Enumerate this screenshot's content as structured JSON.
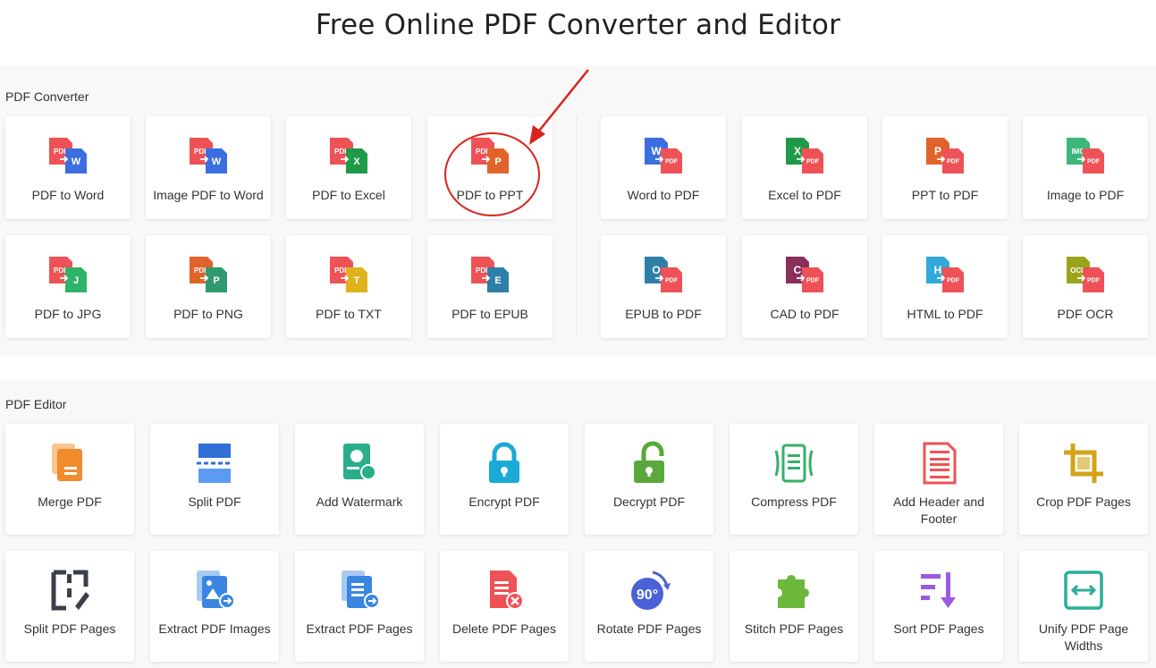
{
  "page": {
    "title": "Free Online PDF Converter and Editor"
  },
  "converter": {
    "label": "PDF Converter",
    "left": [
      {
        "label": "PDF to Word",
        "left_badge": "PDF",
        "left_color": "#ee5256",
        "right_badge": "W",
        "right_color": "#3b6fe0"
      },
      {
        "label": "Image PDF to Word",
        "left_badge": "PDF",
        "left_color": "#ee5256",
        "right_badge": "W",
        "right_color": "#3b6fe0"
      },
      {
        "label": "PDF to Excel",
        "left_badge": "PDF",
        "left_color": "#ee5256",
        "right_badge": "X",
        "right_color": "#1f9a48"
      },
      {
        "label": "PDF to PPT",
        "left_badge": "PDF",
        "left_color": "#ee5256",
        "right_badge": "P",
        "right_color": "#e0632a"
      },
      {
        "label": "PDF to JPG",
        "left_badge": "PDF",
        "left_color": "#ee5256",
        "right_badge": "J",
        "right_color": "#2fb36a"
      },
      {
        "label": "PDF to PNG",
        "left_badge": "PDF",
        "left_color": "#e0632a",
        "right_badge": "P",
        "right_color": "#2f9a6c"
      },
      {
        "label": "PDF to TXT",
        "left_badge": "PDF",
        "left_color": "#ee5256",
        "right_badge": "T",
        "right_color": "#e0b21c"
      },
      {
        "label": "PDF to EPUB",
        "left_badge": "PDF",
        "left_color": "#ee5256",
        "right_badge": "E",
        "right_color": "#2f7fa8"
      }
    ],
    "right": [
      {
        "label": "Word to PDF",
        "left_badge": "W",
        "left_color": "#3b6fe0",
        "right_badge": "PDF",
        "right_color": "#ee5256"
      },
      {
        "label": "Excel to PDF",
        "left_badge": "X",
        "left_color": "#1f9a48",
        "right_badge": "PDF",
        "right_color": "#ee5256"
      },
      {
        "label": "PPT to PDF",
        "left_badge": "P",
        "left_color": "#e0632a",
        "right_badge": "PDF",
        "right_color": "#ee5256"
      },
      {
        "label": "Image to PDF",
        "left_badge": "IMG",
        "left_color": "#3cb67a",
        "right_badge": "PDF",
        "right_color": "#ee5256"
      },
      {
        "label": "EPUB to PDF",
        "left_badge": "O",
        "left_color": "#2f7fa8",
        "right_badge": "PDF",
        "right_color": "#ee5256"
      },
      {
        "label": "CAD to PDF",
        "left_badge": "C",
        "left_color": "#8a2f5c",
        "right_badge": "PDF",
        "right_color": "#ee5256"
      },
      {
        "label": "HTML to PDF",
        "left_badge": "H",
        "left_color": "#33a9d8",
        "right_badge": "PDF",
        "right_color": "#ee5256"
      },
      {
        "label": "PDF OCR",
        "left_badge": "OCR",
        "left_color": "#9aa51c",
        "right_badge": "PDF",
        "right_color": "#ee5256"
      }
    ]
  },
  "editor": {
    "label": "PDF Editor",
    "tools": [
      {
        "label": "Merge PDF",
        "icon": "merge-icon",
        "color": "#f28a2e"
      },
      {
        "label": "Split PDF",
        "icon": "split-icon",
        "color": "#2f6fd6"
      },
      {
        "label": "Add Watermark",
        "icon": "watermark-icon",
        "color": "#2aae8a"
      },
      {
        "label": "Encrypt PDF",
        "icon": "lock-icon",
        "color": "#1ba9d6"
      },
      {
        "label": "Decrypt PDF",
        "icon": "unlock-icon",
        "color": "#5aa83a"
      },
      {
        "label": "Compress PDF",
        "icon": "compress-icon",
        "color": "#35b06a"
      },
      {
        "label": "Add Header and Footer",
        "icon": "header-footer-icon",
        "color": "#ee5256"
      },
      {
        "label": "Crop PDF Pages",
        "icon": "crop-icon",
        "color": "#d3a318"
      },
      {
        "label": "Split PDF Pages",
        "icon": "split-pages-icon",
        "color": "#3b3f4a"
      },
      {
        "label": "Extract PDF Images",
        "icon": "extract-images-icon",
        "color": "#3a86e0"
      },
      {
        "label": "Extract PDF Pages",
        "icon": "extract-pages-icon",
        "color": "#3a86e0"
      },
      {
        "label": "Delete PDF Pages",
        "icon": "delete-pages-icon",
        "color": "#ee5256"
      },
      {
        "label": "Rotate PDF Pages",
        "icon": "rotate-icon",
        "color": "#4a62d6",
        "badge": "90°"
      },
      {
        "label": "Stitch PDF Pages",
        "icon": "puzzle-icon",
        "color": "#6bb83a"
      },
      {
        "label": "Sort PDF Pages",
        "icon": "sort-icon",
        "color": "#9a5ae0"
      },
      {
        "label": "Unify PDF Page Widths",
        "icon": "unify-width-icon",
        "color": "#2aae9a"
      }
    ]
  }
}
